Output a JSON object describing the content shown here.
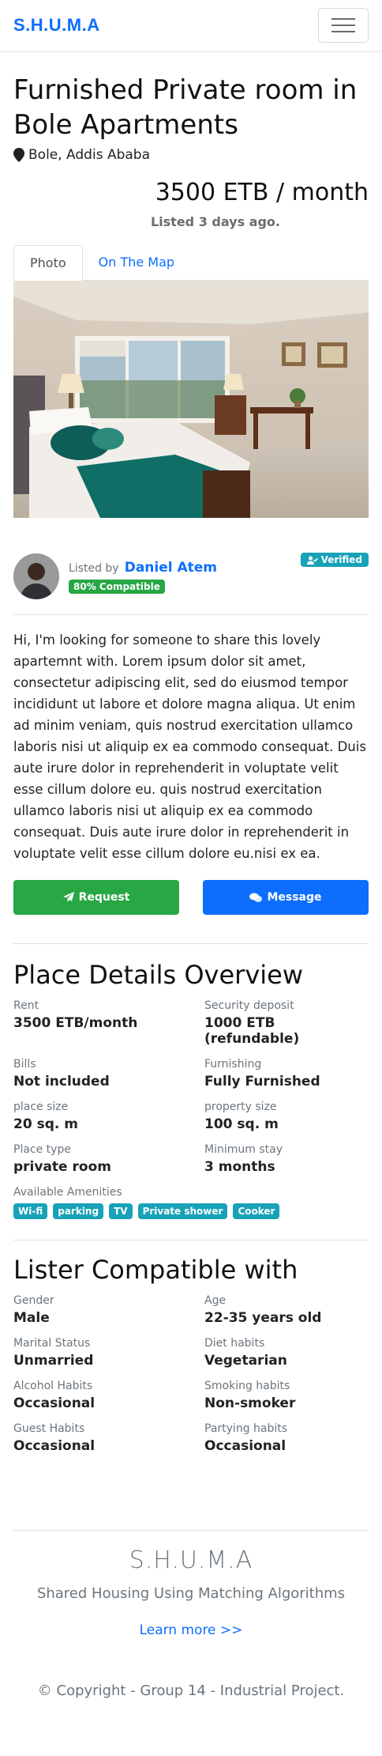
{
  "nav": {
    "brand": "S.H.U.M.A"
  },
  "listing": {
    "title": "Furnished Private room in Bole Apartments",
    "location": "Bole, Addis Ababa",
    "price": "3500 ETB / month",
    "listed_ago": "Listed 3 days ago."
  },
  "tabs": [
    {
      "label": "Photo"
    },
    {
      "label": "On The Map"
    }
  ],
  "lister": {
    "listed_by": "Listed by",
    "name": "Daniel Atem",
    "compatibility": "80% Compatible",
    "verified": "Verified"
  },
  "description": "Hi, I'm looking for someone to share this lovely apartemnt with. Lorem ipsum dolor sit amet, consectetur adipiscing elit, sed do eiusmod tempor incididunt ut labore et dolore magna aliqua. Ut enim ad minim veniam, quis nostrud exercitation ullamco laboris nisi ut aliquip ex ea commodo consequat. Duis aute irure dolor in reprehenderit in voluptate velit esse cillum dolore eu. quis nostrud exercitation ullamco laboris nisi ut aliquip ex ea commodo consequat. Duis aute irure dolor in reprehenderit in voluptate velit esse cillum dolore eu.nisi ex ea.",
  "actions": {
    "request": "Request",
    "message": "Message"
  },
  "place_details": {
    "heading": "Place Details Overview",
    "rows": [
      {
        "label": "Rent",
        "value": "3500 ETB/month"
      },
      {
        "label": "Security deposit",
        "value": "1000 ETB (refundable)"
      },
      {
        "label": "Bills",
        "value": "Not included"
      },
      {
        "label": "Furnishing",
        "value": "Fully Furnished"
      },
      {
        "label": "place size",
        "value": "20 sq. m"
      },
      {
        "label": "property size",
        "value": "100 sq. m"
      },
      {
        "label": "Place type",
        "value": "private room"
      },
      {
        "label": "Minimum stay",
        "value": "3 months"
      }
    ],
    "amenities_label": "Available Amenities",
    "amenities": [
      "Wi-fi",
      "parking",
      "TV",
      "Private shower",
      "Cooker"
    ]
  },
  "compatible": {
    "heading": "Lister Compatible with",
    "rows": [
      {
        "label": "Gender",
        "value": "Male"
      },
      {
        "label": "Age",
        "value": "22-35 years old"
      },
      {
        "label": "Marital Status",
        "value": "Unmarried"
      },
      {
        "label": "Diet habits",
        "value": "Vegetarian"
      },
      {
        "label": "Alcohol Habits",
        "value": "Occasional"
      },
      {
        "label": "Smoking habits",
        "value": "Non-smoker"
      },
      {
        "label": "Guest Habits",
        "value": "Occasional"
      },
      {
        "label": "Partying habits",
        "value": "Occasional"
      }
    ]
  },
  "footer": {
    "brand": "S.H.U.M.A",
    "subtitle": "Shared Housing Using Matching Algorithms",
    "learn_more": "Learn more >>",
    "copyright": "© Copyright - Group 14 - Industrial Project."
  },
  "colors": {
    "primary": "#0d6efd",
    "success": "#28a745",
    "info": "#17a2b8",
    "muted": "#6c757d"
  },
  "icons": {
    "menu": "hamburger-icon",
    "location": "map-marker-icon",
    "request": "paper-plane-icon",
    "message": "comments-icon",
    "verified": "user-check-icon"
  }
}
